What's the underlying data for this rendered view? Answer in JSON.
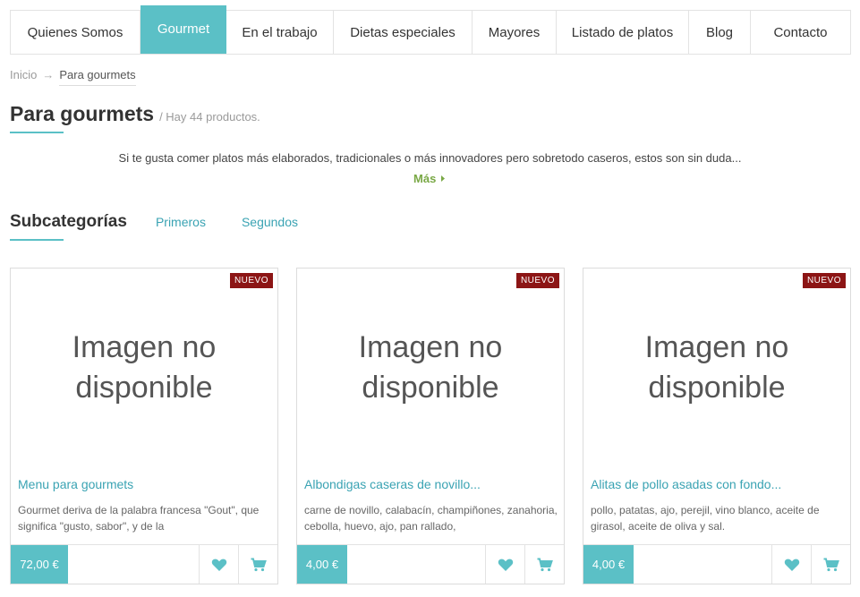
{
  "nav": {
    "items": [
      {
        "label": "Quienes Somos"
      },
      {
        "label": "Gourmet"
      },
      {
        "label": "En el trabajo"
      },
      {
        "label": "Dietas especiales"
      },
      {
        "label": "Mayores"
      },
      {
        "label": "Listado de platos"
      },
      {
        "label": "Blog"
      },
      {
        "label": "Contacto"
      }
    ],
    "active": "Gourmet"
  },
  "breadcrumb": {
    "home": "Inicio",
    "separator": "→",
    "current": "Para gourmets"
  },
  "category": {
    "title": "Para gourmets",
    "count": "/ Hay 44 productos.",
    "description": "Si te gusta comer platos más elaborados, tradicionales o más innovadores pero sobretodo caseros, estos son sin duda...",
    "more": "Más"
  },
  "subcategories": {
    "title": "Subcategorías",
    "items": [
      "Primeros",
      "Segundos"
    ]
  },
  "products": [
    {
      "badge": "NUEVO",
      "image_line1": "Imagen no",
      "image_line2": "disponible",
      "title": "Menu para gourmets",
      "text": "Gourmet deriva de la palabra francesa \"Gout\", que significa \"gusto, sabor\", y de la",
      "price": "72,00 €"
    },
    {
      "badge": "NUEVO",
      "image_line1": "Imagen no",
      "image_line2": "disponible",
      "title": "Albondigas caseras de novillo...",
      "text": "carne de novillo, calabacín, champiñones, zanahoria, cebolla, huevo, ajo, pan rallado,",
      "price": "4,00 €"
    },
    {
      "badge": "NUEVO",
      "image_line1": "Imagen no",
      "image_line2": "disponible",
      "title": "Alitas de pollo asadas con fondo...",
      "text": "pollo, patatas, ajo, perejil, vino blanco, aceite de girasol, aceite de oliva y sal.",
      "price": "4,00 €"
    }
  ],
  "colors": {
    "accent": "#5bc0c6",
    "link": "#3aa3b3",
    "badge": "#8c1515",
    "more": "#79a845"
  },
  "icons": {
    "favorite": "heart-icon",
    "cart": "cart-icon",
    "more": "caret-right-icon"
  }
}
